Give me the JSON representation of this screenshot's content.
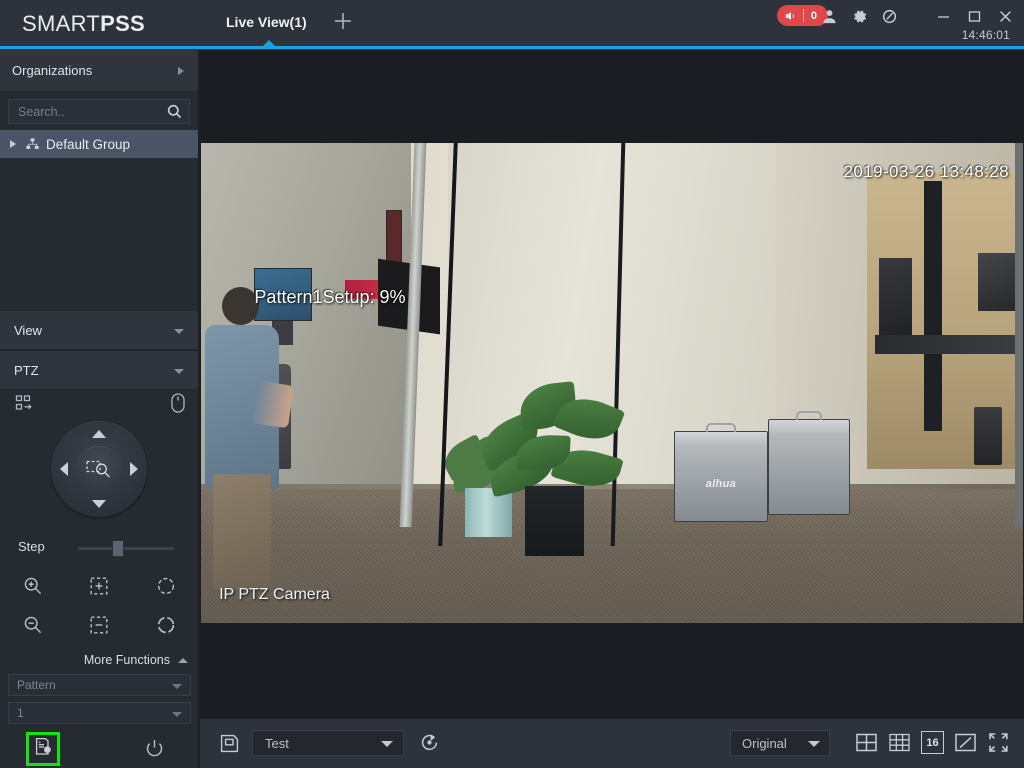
{
  "app": {
    "brand_first": "SMART",
    "brand_second": "PSS",
    "clock": "14:46:01",
    "accent_color": "#1ba1e2",
    "highlight_color": "#14e314",
    "alarm_color": "#e0464a"
  },
  "header": {
    "tab_label": "Live View(1)",
    "add_tab_icon": "plus-icon",
    "alarm": {
      "icon": "speaker-icon",
      "count": "0"
    },
    "icons": [
      {
        "name": "user-icon"
      },
      {
        "name": "gear-icon"
      },
      {
        "name": "dashboard-icon"
      }
    ],
    "window_controls": [
      {
        "name": "minimize-icon"
      },
      {
        "name": "maximize-icon"
      },
      {
        "name": "close-icon"
      }
    ]
  },
  "sidebar": {
    "organizations_label": "Organizations",
    "search": {
      "value": "",
      "placeholder": "Search.."
    },
    "group": {
      "label": "Default Group",
      "icon": "sitemap-icon"
    },
    "sections": [
      {
        "label": "View"
      },
      {
        "label": "PTZ"
      }
    ],
    "ptz": {
      "grid_icon": "preset-grid-icon",
      "mouse_icon": "mouse-icon",
      "directions": [
        "up",
        "right",
        "down",
        "left"
      ],
      "center_icon": "area-zoom-icon",
      "step_label": "Step",
      "step_value": 35,
      "buttons": [
        {
          "name": "zoom-in-button",
          "icon": "zoom-in-icon"
        },
        {
          "name": "focus-near-button",
          "icon": "focus-plus-icon"
        },
        {
          "name": "iris-open-button",
          "icon": "iris-plus-icon"
        },
        {
          "name": "zoom-out-button",
          "icon": "zoom-out-icon"
        },
        {
          "name": "focus-far-button",
          "icon": "focus-minus-icon"
        },
        {
          "name": "iris-close-button",
          "icon": "iris-minus-icon"
        }
      ],
      "more_functions_label": "More Functions",
      "function_select": {
        "value": "Pattern"
      },
      "index_select": {
        "value": "1"
      },
      "save_button": {
        "name": "save-pattern-button",
        "icon": "save-config-icon",
        "highlighted": true
      },
      "power_button": {
        "name": "power-button",
        "icon": "power-icon"
      }
    }
  },
  "video": {
    "timestamp_overlay": "2019-03-26 13:48:28",
    "status_overlay": "Pattern1Setup: 9%",
    "camera_name": "IP PTZ Camera",
    "case_logo": "alhua"
  },
  "bottom_bar": {
    "save_icon": "save-view-icon",
    "view_select": {
      "value": "Test"
    },
    "refresh_icon": "tour-refresh-icon",
    "resolution_select": {
      "value": "Original"
    },
    "layouts": [
      {
        "name": "layout-4-button",
        "label": "4"
      },
      {
        "name": "layout-9-button",
        "label": "9"
      },
      {
        "name": "layout-16-button",
        "label": "16"
      },
      {
        "name": "layout-custom-button",
        "label": "edit"
      },
      {
        "name": "fullscreen-button",
        "label": "fullscreen"
      }
    ]
  }
}
